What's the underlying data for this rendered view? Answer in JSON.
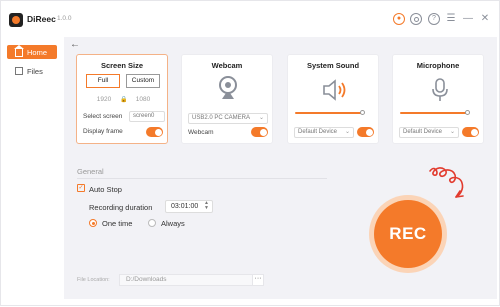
{
  "app": {
    "name": "DiReec",
    "version": "1.0.0"
  },
  "sidebar": {
    "items": [
      {
        "label": "Home",
        "active": true
      },
      {
        "label": "Files",
        "active": false
      }
    ]
  },
  "cards": {
    "screen": {
      "title": "Screen Size",
      "full_label": "Full",
      "custom_label": "Custom",
      "width": "1920",
      "height": "1080",
      "select_label": "Select screen",
      "select_value": "screen0",
      "display_frame_label": "Display frame",
      "display_frame_on": true
    },
    "webcam": {
      "title": "Webcam",
      "device": "USB2.0 PC CAMERA",
      "toggle_label": "Webcam",
      "on": true
    },
    "system_sound": {
      "title": "System Sound",
      "device": "Default Device",
      "volume": 0.95,
      "on": true
    },
    "microphone": {
      "title": "Microphone",
      "device": "Default Device",
      "volume": 0.95,
      "on": true
    }
  },
  "general": {
    "title": "General",
    "auto_stop_label": "Auto Stop",
    "auto_stop_checked": true,
    "duration_label": "Recording duration",
    "duration_value": "03:01:00",
    "one_time_label": "One time",
    "always_label": "Always",
    "selected": "one_time"
  },
  "file": {
    "label": "File Location:",
    "path": "D:/Downloads",
    "more_label": "···"
  },
  "rec": {
    "label": "REC"
  },
  "colors": {
    "accent": "#f47a2a",
    "accent_light": "#fbd4b7",
    "scribble": "#e23b2e"
  }
}
